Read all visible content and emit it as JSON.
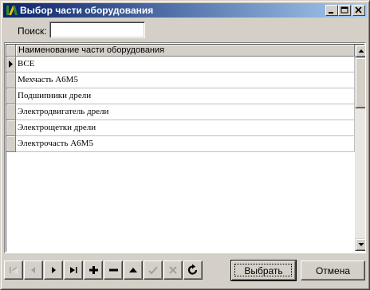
{
  "window": {
    "title": "Выбор части оборудования",
    "accent": "#0a246a"
  },
  "search": {
    "label": "Поиск:",
    "value": "",
    "placeholder": ""
  },
  "grid": {
    "column_header": "Наименование части оборудования",
    "rows": [
      "ВСЕ",
      "Мехчасть А6М5",
      "Подшипники дрели",
      "Электродвигатель дрели",
      "Электрощетки дрели",
      "Электрочасть А6М5"
    ],
    "current_row": 0
  },
  "navigator": {
    "icons": [
      "first-icon",
      "prior-icon",
      "next-icon",
      "last-icon",
      "insert-icon",
      "delete-icon",
      "edit-icon",
      "post-icon",
      "cancel-icon",
      "refresh-icon"
    ]
  },
  "buttons": {
    "select_label": "Выбрать",
    "cancel_label": "Отмена"
  }
}
